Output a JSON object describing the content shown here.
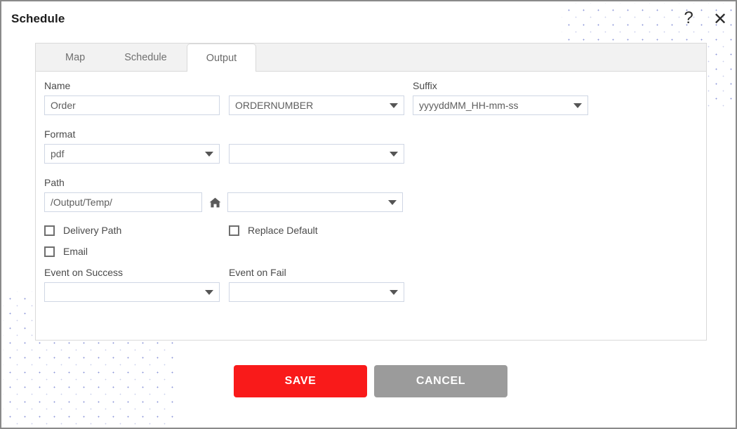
{
  "window": {
    "title": "Schedule",
    "help_icon": "?",
    "close_icon": "✕"
  },
  "tabs": [
    {
      "label": "Map",
      "active": false
    },
    {
      "label": "Schedule",
      "active": false
    },
    {
      "label": "Output",
      "active": true
    }
  ],
  "form": {
    "name": {
      "label": "Name",
      "value": "Order",
      "placeholder": "",
      "token_select": "ORDERNUMBER"
    },
    "suffix": {
      "label": "Suffix",
      "value": "yyyyddMM_HH-mm-ss"
    },
    "format": {
      "label": "Format",
      "value": "pdf",
      "secondary_select": ""
    },
    "path": {
      "label": "Path",
      "value": "/Output/Temp/",
      "home_icon": "home-icon",
      "secondary_select": ""
    },
    "checkboxes": [
      {
        "label": "Delivery Path",
        "checked": false
      },
      {
        "label": "Replace Default",
        "checked": false
      },
      {
        "label": "Email",
        "checked": false
      }
    ],
    "event_on_success": {
      "label": "Event on Success",
      "value": ""
    },
    "event_on_fail": {
      "label": "Event on Fail",
      "value": ""
    }
  },
  "footer": {
    "save_label": "SAVE",
    "cancel_label": "CANCEL"
  },
  "colors": {
    "save": "#F91A1A",
    "cancel": "#9B9B9B",
    "tab_strip": "#F2F2F2",
    "border": "#D9D9D9",
    "input_border": "#CFD6E4",
    "dot_pattern": "#8E97D8"
  }
}
